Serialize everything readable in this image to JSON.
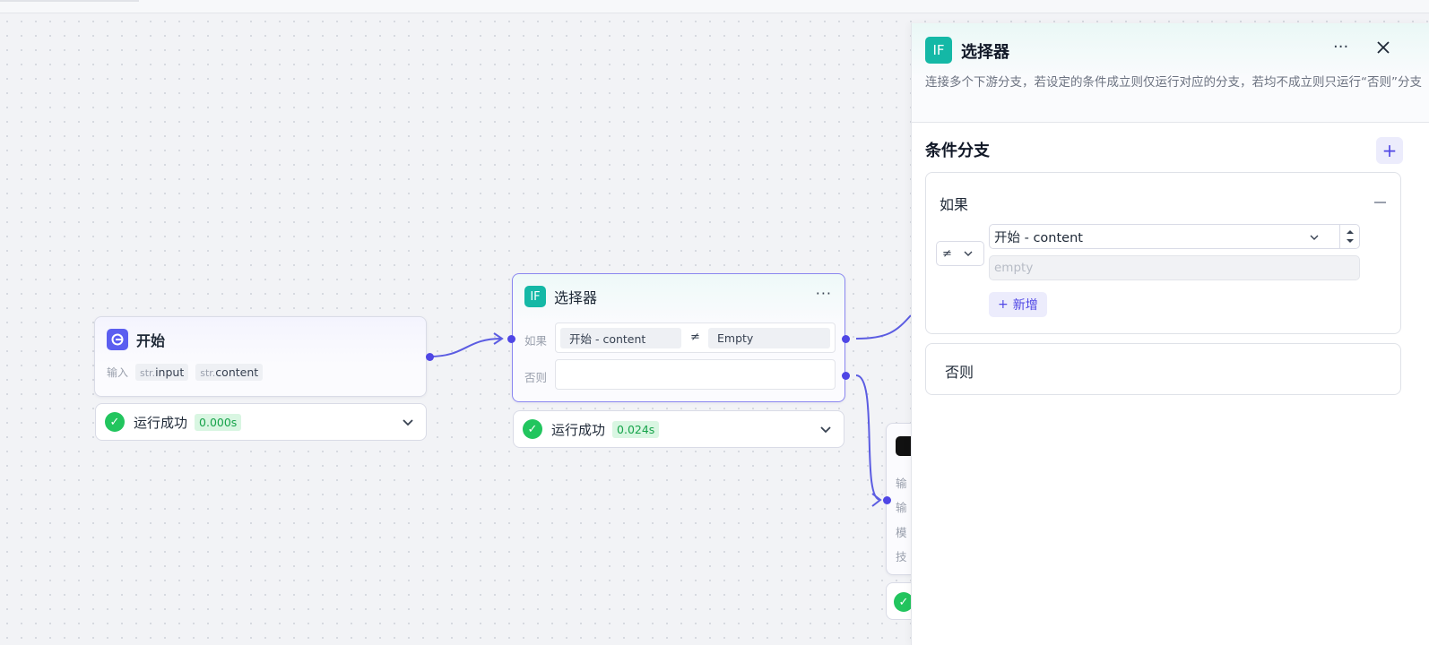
{
  "nodes": {
    "start": {
      "title": "开始",
      "io_label": "输入",
      "vars": [
        {
          "type": "str.",
          "name": "input"
        },
        {
          "type": "str.",
          "name": "content"
        }
      ],
      "status": {
        "text": "运行成功",
        "time": "0.000s"
      }
    },
    "selector": {
      "title": "选择器",
      "icon_text": "IF",
      "if_label": "如果",
      "else_label": "否则",
      "condition": {
        "left": "开始  -  content",
        "operator": "≠",
        "right": "Empty"
      },
      "status": {
        "text": "运行成功",
        "time": "0.024s"
      }
    },
    "llm_partial": {
      "rows": [
        "输",
        "输",
        "模",
        "技"
      ]
    }
  },
  "panel": {
    "icon_text": "IF",
    "title": "选择器",
    "description": "连接多个下游分支，若设定的条件成立则仅运行对应的分支，若均不成立则只运行“否则”分支",
    "section_title": "条件分支",
    "if_card": {
      "label": "如果",
      "operator": "≠",
      "variable": "开始 - content",
      "value_placeholder": "empty",
      "add_label": "新增"
    },
    "else_label": "否则"
  },
  "colors": {
    "accent": "#4f46e5",
    "teal": "#14b8a6",
    "success": "#22c55e",
    "start_icon": "#5b5ef0"
  },
  "icons": [
    "start-node-icon",
    "if-icon",
    "check-icon",
    "chevron-down-icon",
    "more-icon",
    "close-icon",
    "plus-icon",
    "minus-icon"
  ]
}
